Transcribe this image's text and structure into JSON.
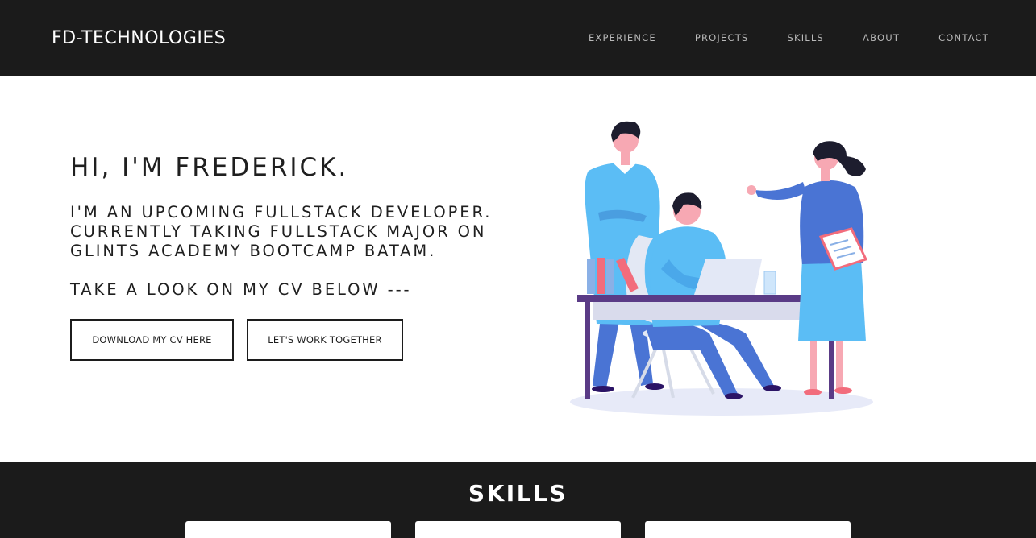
{
  "navbar": {
    "brand": "FD-TECHNOLOGIES",
    "links": [
      "EXPERIENCE",
      "PROJECTS",
      "SKILLS",
      "ABOUT",
      "CONTACT"
    ]
  },
  "hero": {
    "title": "HI, I'M FREDERICK.",
    "subtitle_lines": [
      "I'M AN UPCOMING FULLSTACK DEVELOPER.",
      "CURRENTLY TAKING FULLSTACK MAJOR ON",
      "GLINTS ACADEMY BOOTCAMP BATAM."
    ],
    "cta_text": "TAKE A LOOK ON MY CV BELOW ---",
    "buttons": {
      "download_cv": "DOWNLOAD MY CV HERE",
      "work_together": "LET'S WORK TOGETHER"
    },
    "illustration": "team-working-at-desk-illustration"
  },
  "skills": {
    "title": "SKILLS"
  },
  "colors": {
    "navbar_bg": "#1b1b1b",
    "accent_blue": "#5bbdf5",
    "dark_blue": "#4a74d4"
  }
}
